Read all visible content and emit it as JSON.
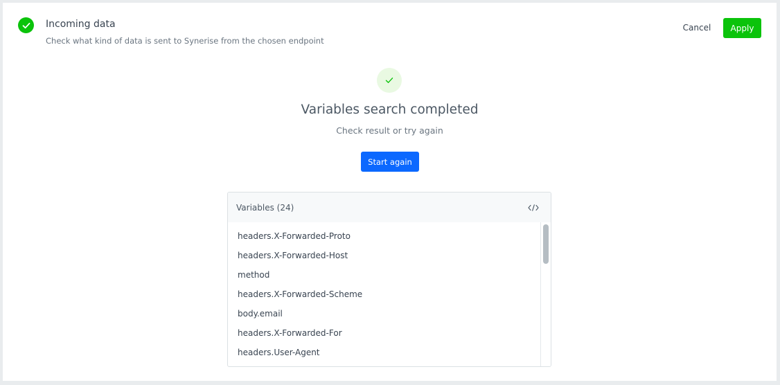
{
  "header": {
    "title": "Incoming data",
    "subtitle": "Check what kind of data is sent to Synerise from the chosen endpoint",
    "cancel_label": "Cancel",
    "apply_label": "Apply",
    "status_icon": "check-circle-icon"
  },
  "result": {
    "icon": "check-icon",
    "title": "Variables search completed",
    "subtitle": "Check result or try again",
    "start_again_label": "Start again"
  },
  "variables": {
    "title": "Variables (24)",
    "code_view_icon": "code-icon",
    "items": [
      "headers.X-Forwarded-Proto",
      "headers.X-Forwarded-Host",
      "method",
      "headers.X-Forwarded-Scheme",
      "body.email",
      "headers.X-Forwarded-For",
      "headers.User-Agent"
    ]
  },
  "colors": {
    "success": "#0bc30b",
    "primary": "#0b68ff",
    "success_light": "#e9f9e2"
  }
}
